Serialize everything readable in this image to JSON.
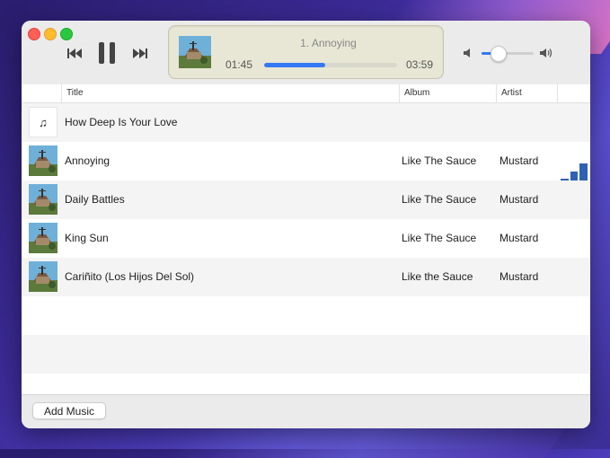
{
  "player": {
    "now_playing_title": "1. Annoying",
    "elapsed": "01:45",
    "total": "03:59",
    "progress": 0.46,
    "volume": 0.31
  },
  "columns": {
    "title": "Title",
    "album": "Album",
    "artist": "Artist"
  },
  "tracks": [
    {
      "title": "How Deep Is Your Love",
      "album": "",
      "artist": "",
      "artwork": "music-note-icon"
    },
    {
      "title": "Annoying",
      "album": "Like The Sauce",
      "artist": "Mustard",
      "artwork": "album-art",
      "playing": true
    },
    {
      "title": "Daily Battles",
      "album": "Like The Sauce",
      "artist": "Mustard",
      "artwork": "album-art"
    },
    {
      "title": "King Sun",
      "album": "Like The Sauce",
      "artist": "Mustard",
      "artwork": "album-art"
    },
    {
      "title": "Cariñito (Los Hijos Del Sol)",
      "album": "Like the Sauce",
      "artist": "Mustard",
      "artwork": "album-art"
    }
  ],
  "footer": {
    "add_music_label": "Add Music"
  },
  "colors": {
    "accent": "#3478f6",
    "lcd_background": "#e8e7d5",
    "playing_indicator": "#2f62b4"
  },
  "icons": {
    "note": "♫"
  }
}
